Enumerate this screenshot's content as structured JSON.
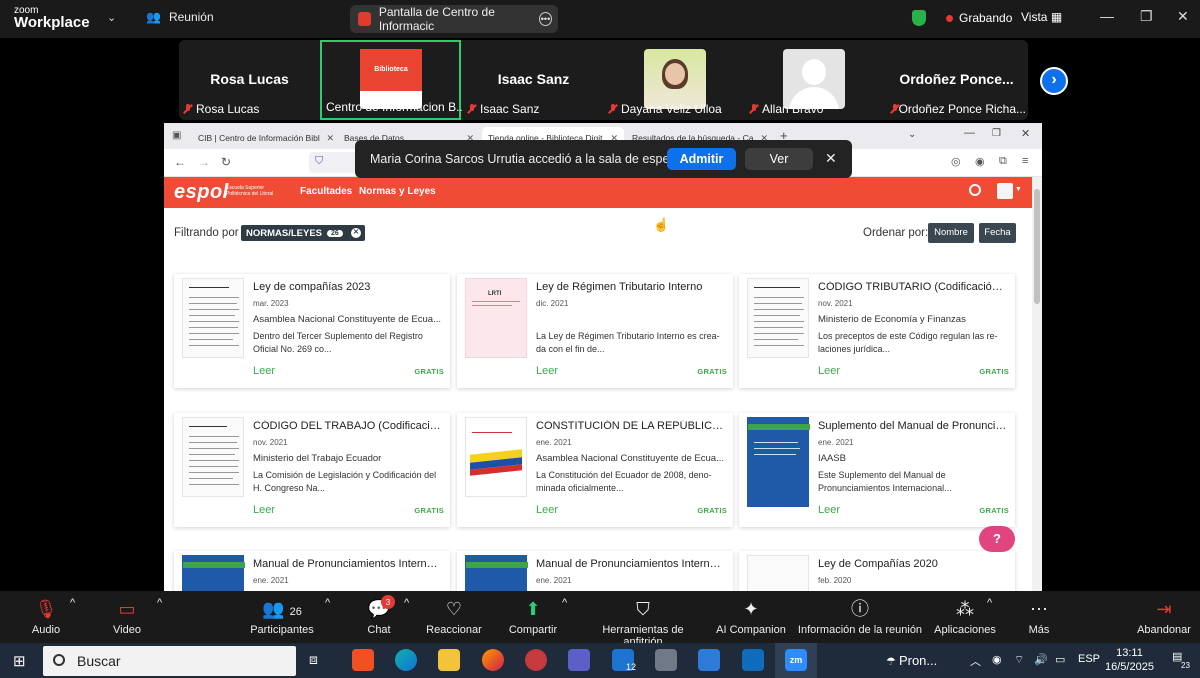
{
  "zoom": {
    "logo_small": "zoom",
    "logo_big": "Workplace",
    "meeting_label": "Reunión",
    "share_title": "Pantalla de Centro de Informacic",
    "recording": "Grabando",
    "view": "Vista",
    "colors": {
      "accent": "#0e71eb",
      "record": "#e53935",
      "secure": "#27b24a"
    }
  },
  "gallery": {
    "tiles": [
      {
        "display": "Rosa Lucas",
        "label": "Rosa Lucas"
      },
      {
        "display": "Biblioteca",
        "label": "Centro de Informacion B..."
      },
      {
        "display": "Isaac Sanz",
        "label": "Isaac Sanz"
      },
      {
        "display": "",
        "label": "Dayana Veliz Ulloa"
      },
      {
        "display": "",
        "label": "Allan Bravo"
      },
      {
        "display": "Ordoñez  Ponce...",
        "label": "Ordoñez Ponce Richa..."
      }
    ]
  },
  "notification": {
    "message": "Maria Corina Sarcos Urrutia accedió a la sala de espera",
    "admit": "Admitir",
    "view": "Ver"
  },
  "browser": {
    "tabs": [
      {
        "label": "CIB | Centro de Información Bibl"
      },
      {
        "label": "Bases de Datos"
      },
      {
        "label": "Tienda online - Biblioteca Digit"
      },
      {
        "label": "Resultados de la búsqueda - Ca"
      }
    ]
  },
  "site": {
    "brand": "espol",
    "brand_sub": "Escuela Superior Politécnica del Litoral",
    "menu": [
      "Facultades",
      "Normas y Leyes"
    ],
    "filter_label": "Filtrando por",
    "filter_chip": "NORMAS/LEYES",
    "filter_count": "26",
    "order_label": "Ordenar por:",
    "order_name": "Nombre",
    "order_date": "Fecha"
  },
  "cards": [
    {
      "title": "Ley de compañías 2023",
      "date": "mar. 2023",
      "author": "Asamblea Nacional Constituyente de Ecua...",
      "desc": "Dentro del Tercer Suplemento del Registro Oficial No. 269 co...",
      "read": "Leer",
      "price": "GRATIS"
    },
    {
      "title": "Ley de Régimen Tributario Interno",
      "date": "dic. 2021",
      "author": "",
      "desc": "La Ley de Régimen Tributario Interno es crea-da con el fin de...",
      "read": "Leer",
      "price": "GRATIS"
    },
    {
      "title": "CÓDIGO TRIBUTARIO (Codificación No...",
      "date": "nov. 2021",
      "author": "Ministerio de Economía y Finanzas",
      "desc": "Los preceptos de este Código regulan las re-laciones jurídica...",
      "read": "Leer",
      "price": "GRATIS"
    },
    {
      "title": "CÓDIGO DEL TRABAJO (Codificación ...",
      "date": "nov. 2021",
      "author": "Ministerio del Trabajo Ecuador",
      "desc": "La Comisión de Legislación y Codificación del H. Congreso Na...",
      "read": "Leer",
      "price": "GRATIS"
    },
    {
      "title": "CONSTITUCIÓN DE LA REPÚBLICA DE...",
      "date": "ene. 2021",
      "author": "Asamblea Nacional Constituyente de Ecua...",
      "desc": "La Constitución del Ecuador de 2008, deno-minada oficialmente...",
      "read": "Leer",
      "price": "GRATIS"
    },
    {
      "title": "Suplemento del Manual de Pronuncia...",
      "date": "ene. 2021",
      "author": "IAASB",
      "desc": "Este Suplemento del Manual de Pronunciamientos Internacional...",
      "read": "Leer",
      "price": "GRATIS"
    },
    {
      "title": "Manual de Pronunciamientos Internac...",
      "date": "ene. 2021"
    },
    {
      "title": "Manual de Pronunciamientos Internac...",
      "date": "ene. 2021"
    },
    {
      "title": "Ley de Compañías 2020",
      "date": "feb. 2020"
    }
  ],
  "toolbar": {
    "audio": "Audio",
    "video": "Video",
    "participants": "Participantes",
    "participants_count": "26",
    "chat": "Chat",
    "chat_badge": "3",
    "react": "Reaccionar",
    "share": "Compartir",
    "host_tools": "Herramientas de anfitrión",
    "ai": "AI Companion",
    "info": "Información de la reunión",
    "apps": "Aplicaciones",
    "more": "Más",
    "leave": "Abandonar"
  },
  "taskbar": {
    "search": "Buscar",
    "weather": "Pron...",
    "lang": "ESP",
    "time": "13:11",
    "date": "16/5/2025",
    "mail_badge": "12",
    "notif_count": "23"
  }
}
